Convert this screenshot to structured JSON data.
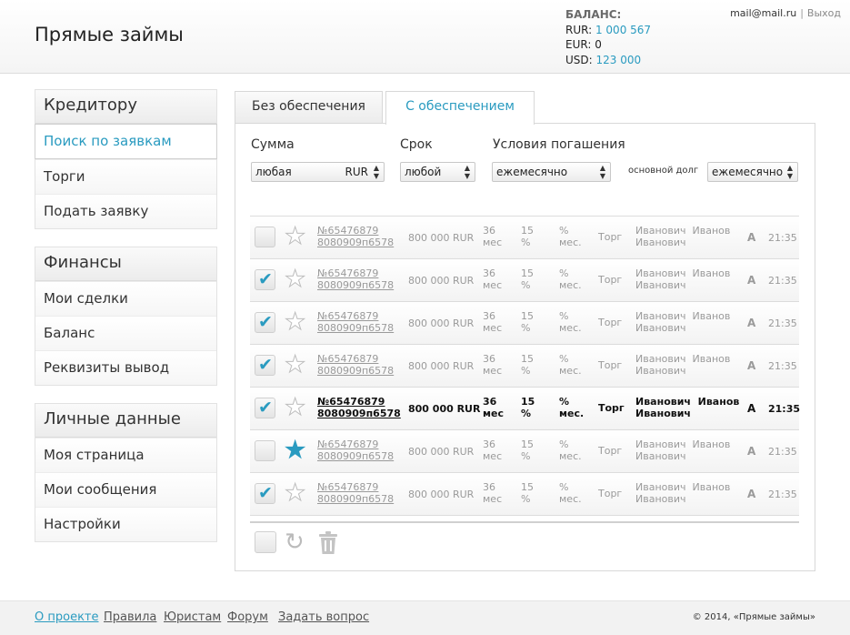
{
  "header": {
    "logo": "Прямые займы",
    "balance_title": "БАЛАНС:",
    "balance": [
      {
        "label": "RUR:",
        "value": "1 000 567"
      },
      {
        "label": "EUR:",
        "value": "0"
      },
      {
        "label": "USD:",
        "value": "123 000"
      }
    ],
    "email": "mail@mail.ru",
    "separator": "|",
    "logout": "Выход"
  },
  "sidebar": {
    "groups": [
      {
        "title": "Кредитору",
        "items": [
          "Поиск по заявкам",
          "Торги",
          "Подать заявку"
        ]
      },
      {
        "title": "Финансы",
        "items": [
          "Мои сделки",
          "Баланс",
          "Реквизиты вывод"
        ]
      },
      {
        "title": "Личные данные",
        "items": [
          "Моя страница",
          "Мои сообщения",
          "Настройки"
        ]
      }
    ]
  },
  "tabs": [
    "Без обеспечения",
    "С обеспечением"
  ],
  "filters": {
    "sum_label": "Сумма",
    "sum_value": "любая",
    "sum_currency": "RUR",
    "term_label": "Срок",
    "term_value": "любой",
    "repay_label": "Условия погашения",
    "repay_value": "ежемесячно",
    "principal_label": "основной долг",
    "principal_value": "ежемесячно"
  },
  "rows": [
    {
      "checked": false,
      "starred": false,
      "bold": false,
      "num": "№65476879",
      "code": "8080909п6578",
      "amount": "800 000 RUR",
      "term1": "36",
      "term2": "мес",
      "pct1": "15",
      "pct2": "%",
      "pm1": "%",
      "pm2": "мес.",
      "type": "Торг",
      "name1": "Иванович  Иванов",
      "name2": "Иванович",
      "grade": "A",
      "time": "21:35"
    },
    {
      "checked": true,
      "starred": false,
      "bold": false,
      "num": "№65476879",
      "code": "8080909п6578",
      "amount": "800 000 RUR",
      "term1": "36",
      "term2": "мес",
      "pct1": "15",
      "pct2": "%",
      "pm1": "%",
      "pm2": "мес.",
      "type": "Торг",
      "name1": "Иванович  Иванов",
      "name2": "Иванович",
      "grade": "A",
      "time": "21:35"
    },
    {
      "checked": true,
      "starred": false,
      "bold": false,
      "num": "№65476879",
      "code": "8080909п6578",
      "amount": "800 000 RUR",
      "term1": "36",
      "term2": "мес",
      "pct1": "15",
      "pct2": "%",
      "pm1": "%",
      "pm2": "мес.",
      "type": "Торг",
      "name1": "Иванович  Иванов",
      "name2": "Иванович",
      "grade": "A",
      "time": "21:35"
    },
    {
      "checked": true,
      "starred": false,
      "bold": false,
      "num": "№65476879",
      "code": "8080909п6578",
      "amount": "800 000 RUR",
      "term1": "36",
      "term2": "мес",
      "pct1": "15",
      "pct2": "%",
      "pm1": "%",
      "pm2": "мес.",
      "type": "Торг",
      "name1": "Иванович  Иванов",
      "name2": "Иванович",
      "grade": "A",
      "time": "21:35"
    },
    {
      "checked": true,
      "starred": false,
      "bold": true,
      "num": "№65476879",
      "code": "8080909п6578",
      "amount": "800 000 RUR",
      "term1": "36",
      "term2": "мес",
      "pct1": "15",
      "pct2": "%",
      "pm1": "%",
      "pm2": "мес.",
      "type": "Торг",
      "name1": "Иванович  Иванов",
      "name2": "Иванович",
      "grade": "A",
      "time": "21:35"
    },
    {
      "checked": false,
      "starred": true,
      "bold": false,
      "num": "№65476879",
      "code": "8080909п6578",
      "amount": "800 000 RUR",
      "term1": "36",
      "term2": "мес",
      "pct1": "15",
      "pct2": "%",
      "pm1": "%",
      "pm2": "мес.",
      "type": "Торг",
      "name1": "Иванович  Иванов",
      "name2": "Иванович",
      "grade": "A",
      "time": "21:35"
    },
    {
      "checked": true,
      "starred": false,
      "bold": false,
      "num": "№65476879",
      "code": "8080909п6578",
      "amount": "800 000 RUR",
      "term1": "36",
      "term2": "мес",
      "pct1": "15",
      "pct2": "%",
      "pm1": "%",
      "pm2": "мес.",
      "type": "Торг",
      "name1": "Иванович  Иванов",
      "name2": "Иванович",
      "grade": "A",
      "time": "21:35"
    }
  ],
  "icons": {
    "checkmark": "✔",
    "star": "★",
    "refresh": "↻",
    "select_arrows": "▲▼"
  },
  "colors": {
    "accent": "#2a9bc0"
  },
  "footer": {
    "links": [
      "О проекте",
      "Правила",
      "Юристам",
      "Форум",
      "Задать вопрос"
    ],
    "copyright": "© 2014, «Прямые займы»"
  }
}
